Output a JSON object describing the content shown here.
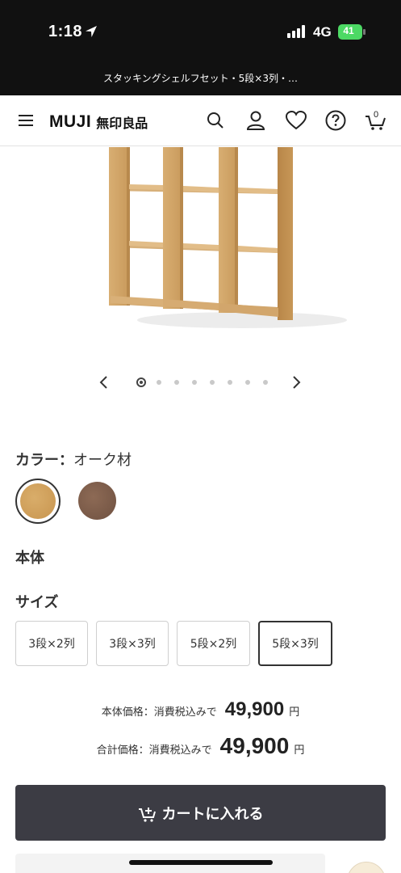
{
  "status_bar": {
    "time": "1:18",
    "network": "4G",
    "battery": "41"
  },
  "browser": {
    "page_title": "スタッキングシェルフセット・5段×3列・…"
  },
  "header": {
    "logo_en": "MUJI",
    "logo_jp": "無印良品",
    "cart_count": "0"
  },
  "carousel": {
    "dot_count": 8,
    "active_index": 0
  },
  "color": {
    "label": "カラー：",
    "selected": "オーク材",
    "swatches": [
      {
        "name": "oak",
        "hex": "#d2a35f"
      },
      {
        "name": "walnut",
        "hex": "#7d5c4a"
      }
    ]
  },
  "body_section": {
    "title": "本体"
  },
  "size": {
    "title": "サイズ",
    "options": [
      "3段×2列",
      "3段×3列",
      "5段×2列",
      "5段×3列"
    ],
    "selected_index": 3
  },
  "price": {
    "body_label": "本体価格：消費税込みで",
    "body_value": "49,900",
    "body_unit": "円",
    "total_label": "合計価格：消費税込みで",
    "total_value": "49,900",
    "total_unit": "円"
  },
  "cart_button": {
    "label": "カートに入れる"
  },
  "colors": {
    "status_bg": "#111111",
    "button_bg": "#3c3c44",
    "oak": "#d2a35f",
    "walnut": "#7d5c4a"
  }
}
